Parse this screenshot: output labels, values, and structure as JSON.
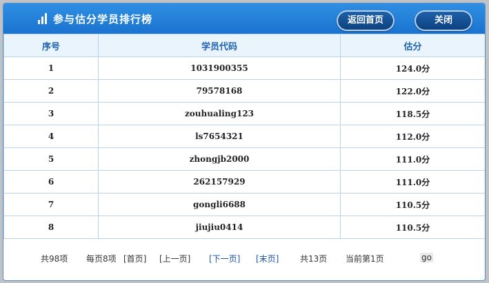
{
  "dialog": {
    "title": "参与估分学员排行榜",
    "back_home_label": "返回首页",
    "close_label": "关闭"
  },
  "table": {
    "headers": [
      "序号",
      "学员代码",
      "估分"
    ],
    "rows": [
      [
        "1",
        "1031900355",
        "124.0分"
      ],
      [
        "2",
        "79578168",
        "122.0分"
      ],
      [
        "3",
        "zouhualing123",
        "118.5分"
      ],
      [
        "4",
        "ls7654321",
        "112.0分"
      ],
      [
        "5",
        "zhongjb2000",
        "111.0分"
      ],
      [
        "6",
        "262157929",
        "111.0分"
      ],
      [
        "7",
        "gongli6688",
        "110.5分"
      ],
      [
        "8",
        "jiujiu0414",
        "110.5分"
      ]
    ]
  },
  "pager": {
    "total": "共98项",
    "per_page": "每页8项",
    "first": "[首页]",
    "prev": "[上一页]",
    "next": "[下一页]",
    "last": "[末页]",
    "pages": "共13页",
    "current": "当前第1页",
    "go": "go"
  },
  "colors": {
    "titlebar": "#1a73cf",
    "header_text": "#1f63b3",
    "link": "#1c52a6"
  }
}
